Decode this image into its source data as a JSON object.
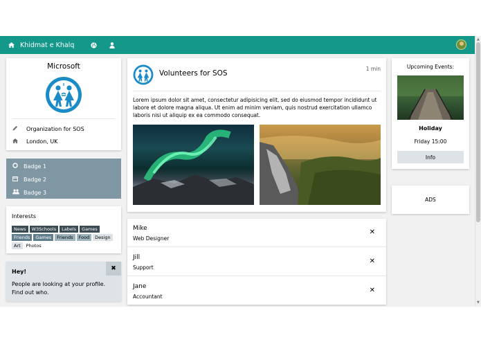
{
  "nav": {
    "brand": "Khidmat e Khalq",
    "icons": [
      "home-icon",
      "globe-icon",
      "user-icon"
    ]
  },
  "profile": {
    "name": "Microsoft",
    "organization": "Organization for SOS",
    "location": "London, UK"
  },
  "badges": [
    {
      "label": "Badge 1",
      "icon": "circle-icon"
    },
    {
      "label": "Badge 2",
      "icon": "calendar-icon"
    },
    {
      "label": "Badge 3",
      "icon": "users-icon"
    }
  ],
  "interests": {
    "title": "Interests",
    "tags": [
      {
        "label": "News",
        "style": "dark"
      },
      {
        "label": "W3Schools",
        "style": "dark"
      },
      {
        "label": "Labels",
        "style": "dark"
      },
      {
        "label": "Games",
        "style": "dark"
      },
      {
        "label": "Friends",
        "style": "mid"
      },
      {
        "label": "Games",
        "style": "mid"
      },
      {
        "label": "Friends",
        "style": "light"
      },
      {
        "label": "Food",
        "style": "light"
      },
      {
        "label": "Design",
        "style": "pale"
      },
      {
        "label": "Art",
        "style": "pale"
      },
      {
        "label": "Photos",
        "style": "none"
      }
    ]
  },
  "alert": {
    "heading": "Hey!",
    "text": "People are looking at your profile. Find out who.",
    "close": "✖"
  },
  "post": {
    "title": "Volunteers for SOS",
    "time": "1 min",
    "text": "Lorem ipsum dolor sit amet, consectetur adipisicing elit, sed do eiusmod tempor incididunt ut labore et dolore magna aliqua. Ut enim ad minim veniam, quis nostrud exercitation ullamco laboris nisi ut aliquip ex ea commodo consequat."
  },
  "people": [
    {
      "name": "Mike",
      "role": "Web Designer"
    },
    {
      "name": "Jill",
      "role": "Support"
    },
    {
      "name": "Jane",
      "role": "Accountant"
    }
  ],
  "people_close": "✕",
  "events": {
    "title": "Upcoming Events:",
    "name": "Holiday",
    "date": "Friday 15:00",
    "button": "Info"
  },
  "ads": "ADS",
  "colors": {
    "primary": "#14988a",
    "badge_bg": "#7f97a3",
    "alert_bg": "#dde3e6"
  }
}
